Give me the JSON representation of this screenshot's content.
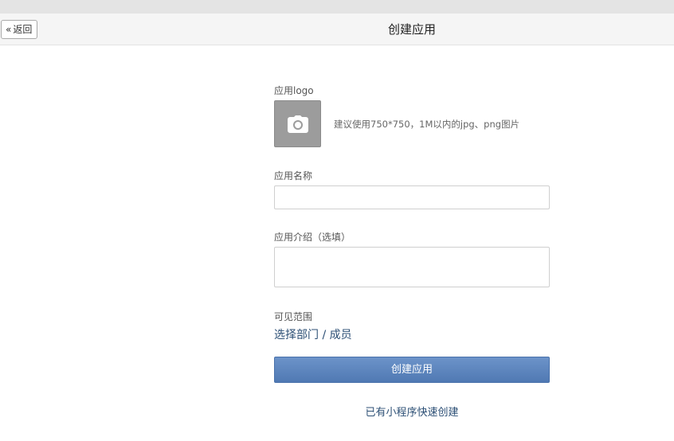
{
  "header": {
    "back_label": "返回",
    "title": "创建应用"
  },
  "form": {
    "logo_label": "应用logo",
    "logo_icon": "camera-icon",
    "logo_hint": "建议使用750*750，1M以内的jpg、png图片",
    "name_label": "应用名称",
    "name_value": "",
    "intro_label": "应用介绍（选填）",
    "intro_value": "",
    "visibility_label": "可见范围",
    "visibility_link": "选择部门 / 成员",
    "create_button": "创建应用",
    "quick_create_link": "已有小程序快速创建"
  },
  "colors": {
    "primary_button": "#5e86c0",
    "link": "#2c4f75",
    "logo_placeholder": "#9c9c9c"
  }
}
